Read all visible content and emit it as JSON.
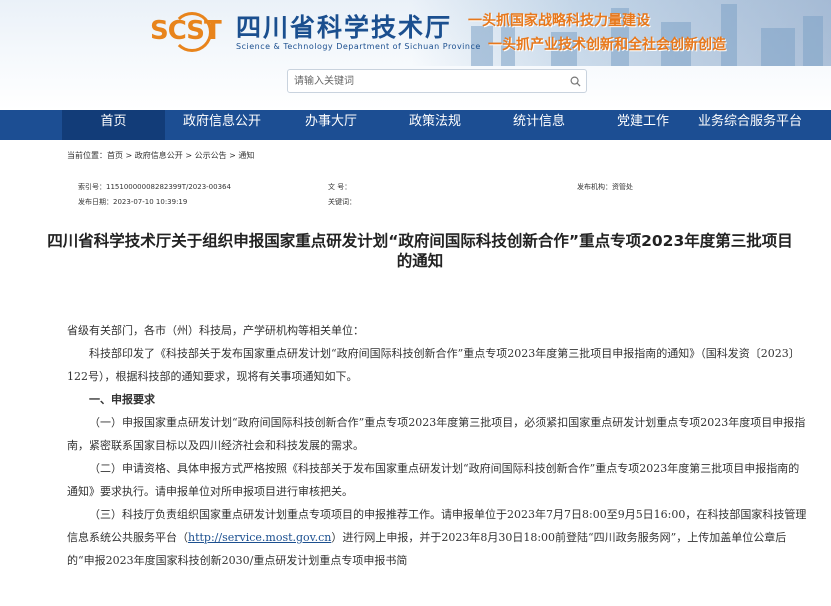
{
  "site": {
    "name_cn": "四川省科学技术厅",
    "name_en": "Science & Technology Department of Sichuan Province",
    "logo_letters": "SCST",
    "slogan_1": "一头抓国家战略科技力量建设",
    "slogan_2": "一头抓产业技术创新和全社会创新创造"
  },
  "search": {
    "placeholder": "请输入关键词"
  },
  "nav": [
    "首页",
    "政府信息公开",
    "办事大厅",
    "政策法规",
    "统计信息",
    "党建工作",
    "业务综合服务平台"
  ],
  "breadcrumb": "当前位置：首页 > 政府信息公开 > 公示公告 > 通知",
  "meta": {
    "index_no": "索引号：11510000008282399T/2023-00364",
    "doc_no": "文 号：",
    "issuer": "发布机构：资管处",
    "date": "发布日期：2023-07-10 10:39:19",
    "keywords": "关键词："
  },
  "title": "四川省科学技术厅关于组织申报国家重点研发计划“政府间国际科技创新合作”重点专项2023年度第三批项目的通知",
  "content": {
    "salutation": "省级有关部门，各市（州）科技局，产学研机构等相关单位：",
    "p1": "科技部印发了《科技部关于发布国家重点研发计划“政府间国际科技创新合作”重点专项2023年度第三批项目申报指南的通知》（国科发资〔2023〕122号），根据科技部的通知要求，现将有关事项通知如下。",
    "section_1": "一、申报要求",
    "item_1": "（一）申报国家重点研发计划“政府间国际科技创新合作”重点专项2023年度第三批项目，必须紧扣国家重点研发计划重点专项2023年度项目申报指南，紧密联系国家目标以及四川经济社会和科技发展的需求。",
    "item_2": "（二）申请资格、具体申报方式严格按照《科技部关于发布国家重点研发计划“政府间国际科技创新合作”重点专项2023年度第三批项目申报指南的通知》要求执行。请申报单位对所申报项目进行审核把关。",
    "item_3_a": "（三）科技厅负责组织国家重点研发计划重点专项项目的申报推荐工作。请申报单位于2023年7月7日8:00至9月5日16:00，在科技部国家科技管理信息系统公共服务平台（",
    "item_3_link": "http://service.most.gov.cn",
    "item_3_b": "）进行网上申报，并于2023年8月30日18:00前登陆“四川政务服务网”，上传加盖单位公章后的“申报2023年度国家科技创新2030/重点研发计划重点专项申报书简"
  }
}
